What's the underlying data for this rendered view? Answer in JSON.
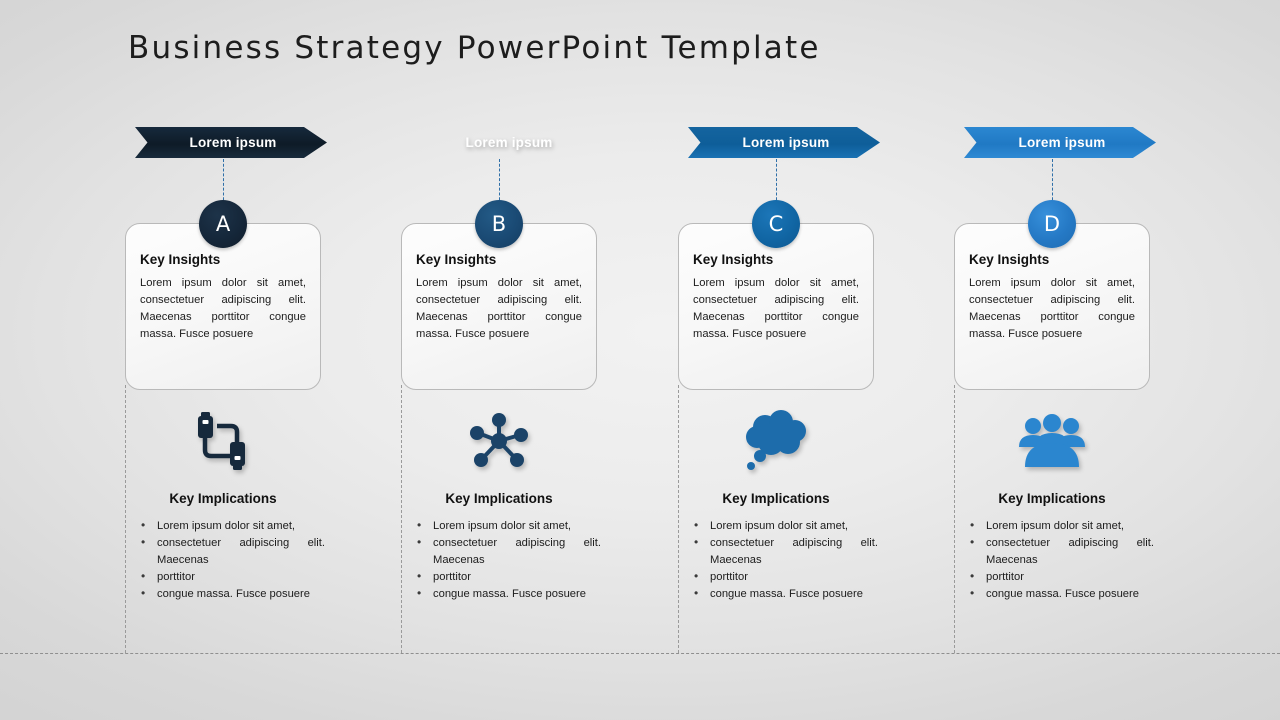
{
  "page": {
    "title": "Business Strategy PowerPoint Template",
    "background_color": "#e4e4e4"
  },
  "columns": [
    {
      "id": "col-0",
      "letter": "A",
      "banner_label": "Lorem ipsum",
      "banner_color": "#0e1b27",
      "circle_color": "#15273a",
      "icon": "usb-cable-icon",
      "icon_color": "#16293c",
      "insights_title": "Key Insights",
      "insights_body": "Lorem ipsum dolor sit amet, consectetuer adipiscing elit. Maecenas porttitor congue massa. Fusce posuere",
      "implications_title": "Key Implications",
      "implications": [
        "Lorem ipsum dolor sit amet,",
        "consectetuer adipiscing elit. Maecenas",
        " porttitor",
        "congue massa. Fusce posuere"
      ]
    },
    {
      "id": "col-1",
      "letter": "B",
      "banner_label": "Lorem ipsum",
      "banner_color": "#1b4368",
      "circle_color": "#1a4a74",
      "icon": "network-hub-icon",
      "icon_color": "#1b4368",
      "insights_title": "Key Insights",
      "insights_body": "Lorem ipsum dolor sit amet, consectetuer adipiscing elit. Maecenas porttitor congue massa. Fusce posuere",
      "implications_title": "Key Implications",
      "implications": [
        "Lorem ipsum dolor sit amet,",
        "consectetuer adipiscing elit. Maecenas",
        " porttitor",
        "congue massa. Fusce posuere"
      ]
    },
    {
      "id": "col-2",
      "letter": "C",
      "banner_label": "Lorem ipsum",
      "banner_color": "#0e5e99",
      "circle_color": "#1166a4",
      "icon": "thought-cloud-icon",
      "icon_color": "#1d6cab",
      "insights_title": "Key Insights",
      "insights_body": "Lorem ipsum dolor sit amet, consectetuer adipiscing elit. Maecenas porttitor congue massa. Fusce posuere",
      "implications_title": "Key Implications",
      "implications": [
        "Lorem ipsum dolor sit amet,",
        "consectetuer adipiscing elit. Maecenas",
        " porttitor",
        "congue massa. Fusce posuere"
      ]
    },
    {
      "id": "col-3",
      "letter": "D",
      "banner_label": "Lorem ipsum",
      "banner_color": "#2079c4",
      "circle_color": "#2579c5",
      "icon": "team-group-icon",
      "icon_color": "#2b86cf",
      "insights_title": "Key Insights",
      "insights_body": "Lorem ipsum dolor sit amet, consectetuer adipiscing elit. Maecenas porttitor congue massa. Fusce posuere",
      "implications_title": "Key Implications",
      "implications": [
        "Lorem ipsum dolor sit amet,",
        "consectetuer adipiscing elit. Maecenas",
        " porttitor",
        "congue massa. Fusce posuere"
      ]
    }
  ]
}
